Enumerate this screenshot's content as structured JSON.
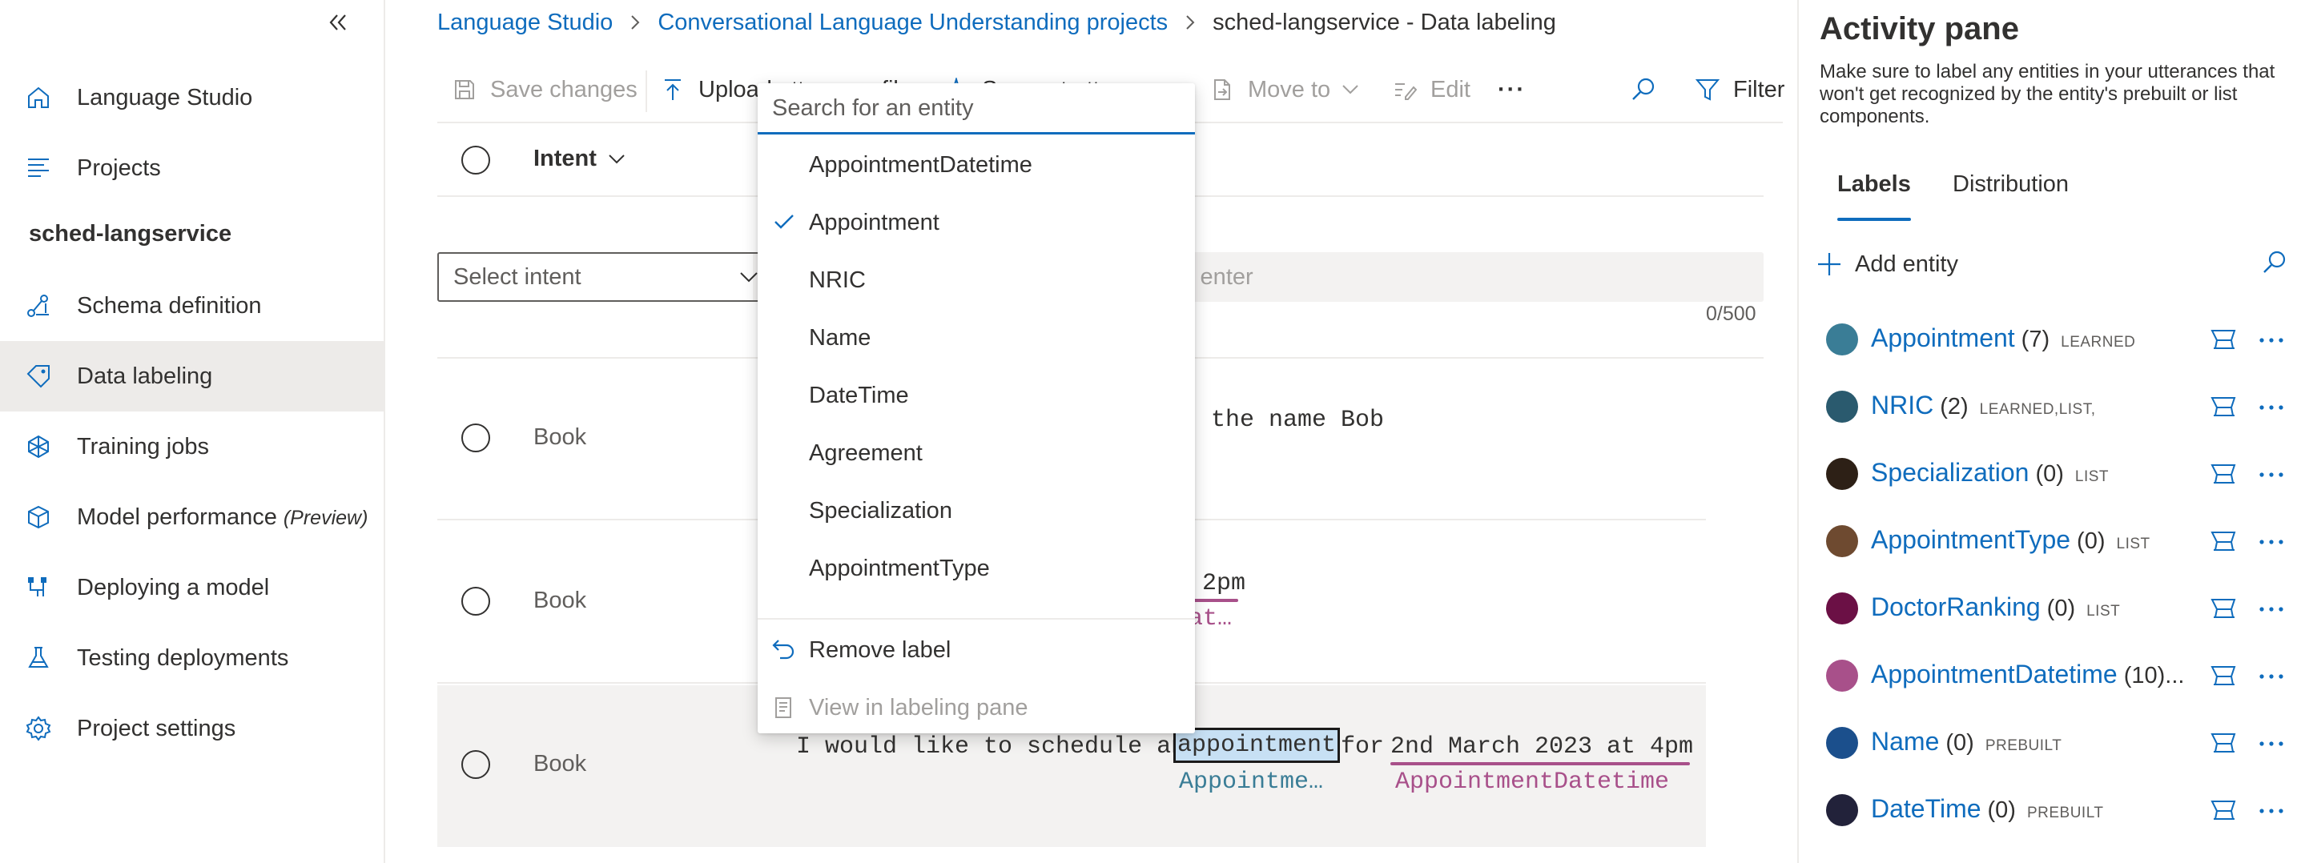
{
  "colors": {
    "accent": "#0f6cbd",
    "active_nav_bg": "#edebe9"
  },
  "sidebar": {
    "collapse_icon": "chevron-double-left-icon",
    "top_items": [
      {
        "label": "Language Studio",
        "icon": "home-icon"
      },
      {
        "label": "Projects",
        "icon": "list-icon"
      }
    ],
    "project_name": "sched-langservice",
    "project_items": [
      {
        "label": "Schema definition",
        "icon": "schema-icon"
      },
      {
        "label": "Data labeling",
        "icon": "tag-icon",
        "active": true
      },
      {
        "label": "Training jobs",
        "icon": "training-icon"
      },
      {
        "label": "Model performance",
        "suffix": "(Preview)",
        "icon": "cube-icon"
      },
      {
        "label": "Deploying a model",
        "icon": "deploy-icon"
      },
      {
        "label": "Testing deployments",
        "icon": "flask-icon"
      },
      {
        "label": "Project settings",
        "icon": "gear-icon"
      }
    ]
  },
  "breadcrumb": {
    "items": [
      "Language Studio",
      "Conversational Language Understanding projects"
    ],
    "current": "sched-langservice - Data labeling"
  },
  "toolbar": {
    "save": "Save changes",
    "upload": "Upload utterance file",
    "suggest": "Suggest utterances",
    "move_to": "Move to",
    "edit": "Edit",
    "more": "···",
    "filter": "Filter"
  },
  "table": {
    "intent_header": "Intent",
    "select_intent_placeholder": "Select intent",
    "utterance_placeholder_visible": "s enter",
    "counter": "0/500",
    "rows": [
      {
        "intent": "Book",
        "utterance_visible": "r the name Bob"
      },
      {
        "intent": "Book",
        "utterance_visible": "2pm",
        "label_visible": "at…"
      },
      {
        "intent": "Book",
        "utterance_prefix": "I would like to schedule an ",
        "selected_word": "appointment",
        "utterance_mid": " for ",
        "datetime_text": "2nd March 2023 at 4pm",
        "label_1": "Appointme…",
        "label_2": "AppointmentDatetime"
      }
    ]
  },
  "dropdown": {
    "search_placeholder": "Search for an entity",
    "items": [
      {
        "label": "AppointmentDatetime",
        "checked": false
      },
      {
        "label": "Appointment",
        "checked": true
      },
      {
        "label": "NRIC",
        "checked": false
      },
      {
        "label": "Name",
        "checked": false
      },
      {
        "label": "DateTime",
        "checked": false
      },
      {
        "label": "Agreement",
        "checked": false
      },
      {
        "label": "Specialization",
        "checked": false
      },
      {
        "label": "AppointmentType",
        "checked": false
      }
    ],
    "remove_label": "Remove label",
    "view_label": "View in labeling pane"
  },
  "activity_pane": {
    "title": "Activity pane",
    "description": "Make sure to label any entities in your utterances that won't get recognized by the entity's prebuilt or list components.",
    "tabs": [
      "Labels",
      "Distribution"
    ],
    "add_entity": "Add entity",
    "entities": [
      {
        "name": "Appointment",
        "count": "(7)",
        "tag": "LEARNED",
        "color": "#3a7d96"
      },
      {
        "name": "NRIC",
        "count": "(2)",
        "tag": "LEARNED,LIST,",
        "color": "#2a5a6e"
      },
      {
        "name": "Specialization",
        "count": "(0)",
        "tag": "LIST",
        "color": "#2d2016"
      },
      {
        "name": "AppointmentType",
        "count": "(0)",
        "tag": "LIST",
        "color": "#6e4a30"
      },
      {
        "name": "DoctorRanking",
        "count": "(0)",
        "tag": "LIST",
        "color": "#6b1045"
      },
      {
        "name": "AppointmentDatetime",
        "count": "(10)...",
        "tag": "",
        "color": "#a8508a"
      },
      {
        "name": "Name",
        "count": "(0)",
        "tag": "PREBUILT",
        "color": "#1b4f8c"
      },
      {
        "name": "DateTime",
        "count": "(0)",
        "tag": "PREBUILT",
        "color": "#22223a"
      }
    ]
  }
}
